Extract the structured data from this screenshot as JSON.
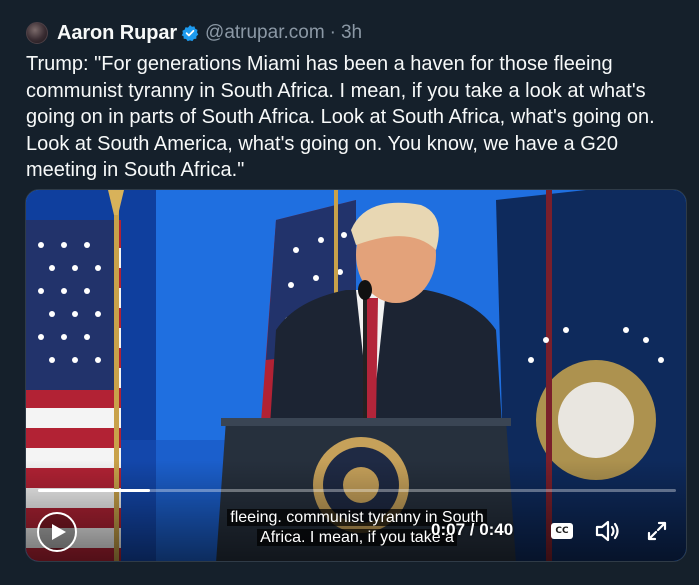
{
  "tweet": {
    "author_name": "Aaron Rupar",
    "handle": "@atrupar.com",
    "separator": "·",
    "time": "3h",
    "verified": true,
    "text": "Trump: \"For generations Miami has been a haven for those fleeing communist tyranny in South Africa. I mean, if you take a look at what's going on in parts of South Africa. Look at South Africa, what's going on. Look at South America, what's going on. You know, we have a G20 meeting in South Africa.\""
  },
  "video": {
    "caption_line1": "fleeing. communist tyranny in South",
    "caption_line2": "Africa. I mean, if you take a",
    "current_time": "0:07",
    "duration": "0:40",
    "timecode": "0:07 / 0:40",
    "progress_fraction": 0.175,
    "cc_label": "CC",
    "play_icon": "play-icon",
    "volume_icon": "volume-icon",
    "fullscreen_icon": "fullscreen-icon"
  },
  "colors": {
    "background": "#15202b",
    "verified_badge": "#1d9bf0",
    "secondary_text": "#8b98a5",
    "stage_blue": "#1f6fe0"
  }
}
